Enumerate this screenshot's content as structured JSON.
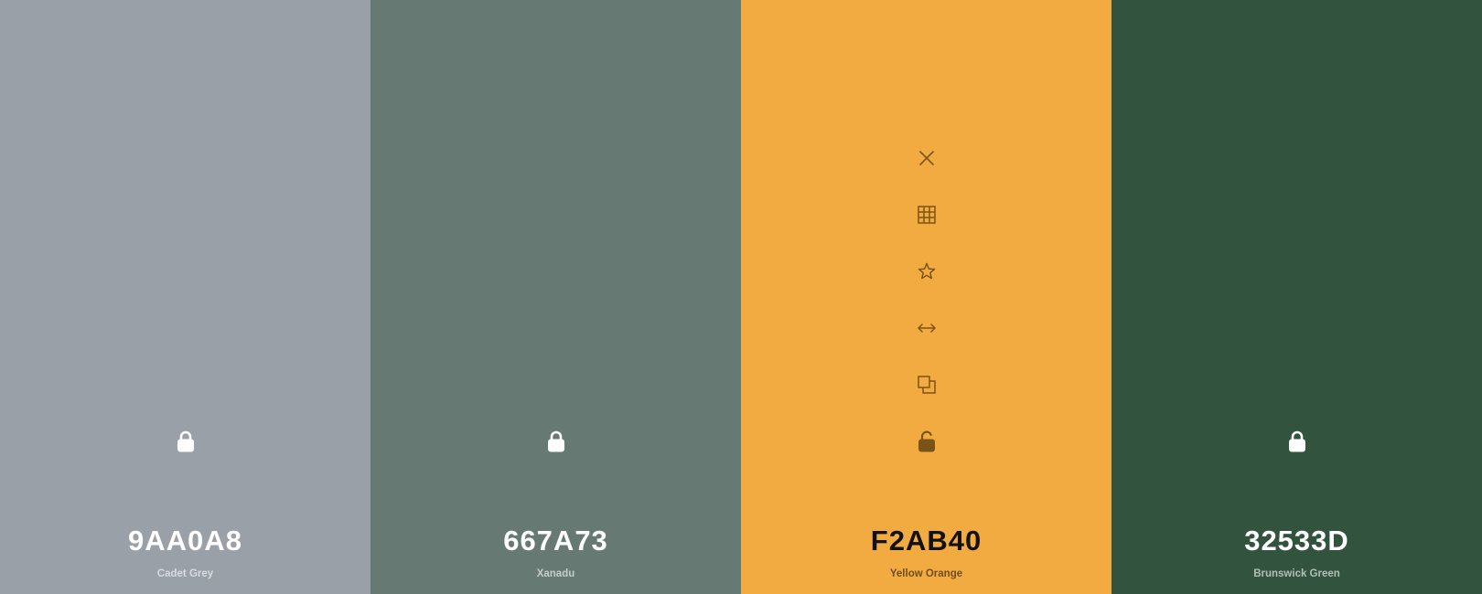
{
  "palette": {
    "colors": [
      {
        "hex": "9AA0A8",
        "name": "Cadet Grey",
        "bg": "#9AA0A8",
        "locked": true,
        "lock_icon": "lock-closed-icon"
      },
      {
        "hex": "667A73",
        "name": "Xanadu",
        "bg": "#667A73",
        "locked": true,
        "lock_icon": "lock-closed-icon"
      },
      {
        "hex": "F2AB40",
        "name": "Yellow Orange",
        "bg": "#F2AB40",
        "locked": false,
        "lock_icon": "lock-open-icon",
        "hovered": true,
        "tools": [
          "close-icon",
          "grid-icon",
          "star-icon",
          "arrows-horizontal-icon",
          "copy-icon",
          "lock-open-icon"
        ]
      },
      {
        "hex": "32533D",
        "name": "Brunswick Green",
        "bg": "#32533D",
        "locked": true,
        "lock_icon": "lock-closed-icon"
      }
    ],
    "tool_icon_color": "#7A5417"
  }
}
